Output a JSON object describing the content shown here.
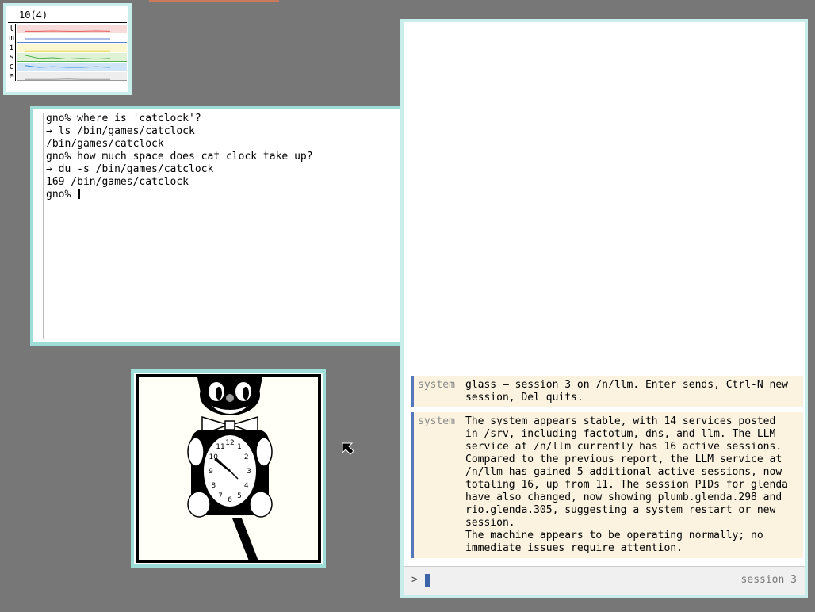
{
  "stats": {
    "header": "10(4)",
    "rows": [
      {
        "label": "l",
        "color": "#e85a5a",
        "fill": "#f8dcdc"
      },
      {
        "label": "m",
        "color": "#5b7fd1",
        "fill": "#ffffff"
      },
      {
        "label": "i",
        "color": "#e8d84a",
        "fill": "#fbf7d2"
      },
      {
        "label": "s",
        "color": "#4fb04f",
        "fill": "#dff2d5"
      },
      {
        "label": "c",
        "color": "#3a8ad8",
        "fill": "#cfe4f7"
      },
      {
        "label": "e",
        "color": "#999999",
        "fill": "#eeeeee"
      }
    ]
  },
  "terminal": {
    "lines": [
      "gno% where is 'catclock'?",
      "→ ls /bin/games/catclock",
      "/bin/games/catclock",
      "gno% how much space does cat clock take up?",
      "→ du -s /bin/games/catclock",
      "169 /bin/games/catclock",
      "gno% "
    ]
  },
  "clock": {
    "numbers": [
      "12",
      "1",
      "2",
      "3",
      "4",
      "5",
      "6",
      "7",
      "8",
      "9",
      "10",
      "11"
    ]
  },
  "glass": {
    "messages": [
      {
        "who": "system",
        "text": "glass — session 3 on /n/llm. Enter sends, Ctrl-N new\nsession, Del quits."
      },
      {
        "who": "system",
        "text": "The system appears stable, with 14 services posted\nin /srv, including factotum, dns, and llm. The LLM\nservice at /n/llm currently has 16 active sessions.\nCompared to the previous report, the LLM service at\n/n/llm has gained 5 additional active sessions, now\ntotaling 16, up from 11. The session PIDs for glenda\nhave also changed, now showing plumb.glenda.298 and\nrio.glenda.305, suggesting a system restart or new\nsession.\nThe machine appears to be operating normally; no\nimmediate issues require attention."
      }
    ],
    "prompt": ">",
    "session_label": "session 3"
  }
}
